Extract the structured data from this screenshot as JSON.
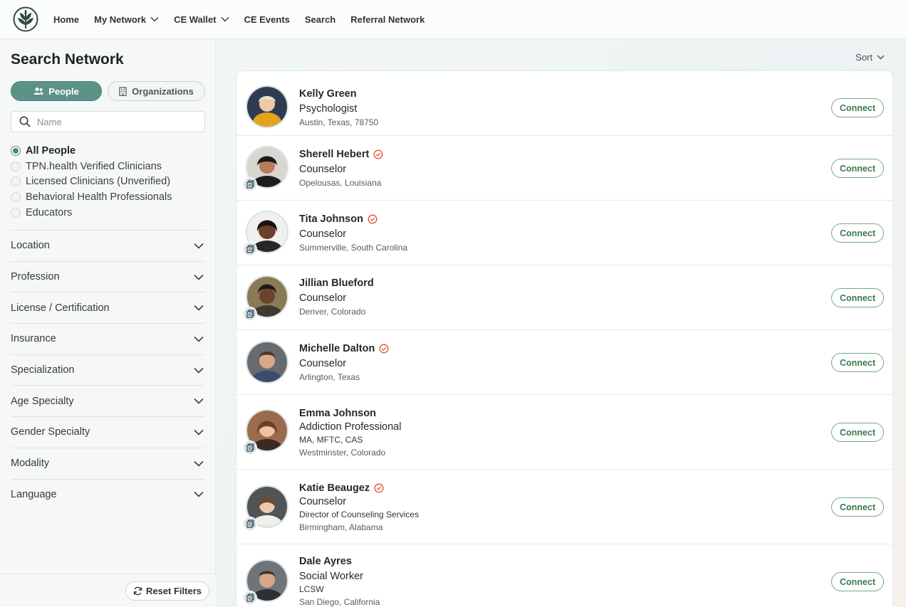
{
  "nav": {
    "items": [
      {
        "label": "Home",
        "dropdown": false
      },
      {
        "label": "My Network",
        "dropdown": true
      },
      {
        "label": "CE Wallet",
        "dropdown": true
      },
      {
        "label": "CE Events",
        "dropdown": false
      },
      {
        "label": "Search",
        "dropdown": false
      },
      {
        "label": "Referral Network",
        "dropdown": false
      }
    ]
  },
  "sidebar": {
    "title": "Search Network",
    "tabs": {
      "people": "People",
      "organizations": "Organizations",
      "active": "people"
    },
    "search": {
      "placeholder": "Name",
      "value": ""
    },
    "audience": [
      {
        "label": "All People",
        "selected": true
      },
      {
        "label": "TPN.health Verified Clinicians",
        "selected": false
      },
      {
        "label": "Licensed Clinicians (Unverified)",
        "selected": false
      },
      {
        "label": "Behavioral Health Professionals",
        "selected": false
      },
      {
        "label": "Educators",
        "selected": false
      }
    ],
    "filters": [
      "Location",
      "Profession",
      "License / Certification",
      "Insurance",
      "Specialization",
      "Age Specialty",
      "Gender Specialty",
      "Modality",
      "Language"
    ],
    "reset_label": "Reset Filters"
  },
  "main": {
    "sort_label": "Sort",
    "connect_label": "Connect",
    "results": [
      {
        "name": "Kelly Green",
        "verified": false,
        "doc_badge": false,
        "role": "Psychologist",
        "credentials": "",
        "location": "Austin, Texas, 78750"
      },
      {
        "name": "Sherell Hebert",
        "verified": true,
        "doc_badge": true,
        "role": "Counselor",
        "credentials": "",
        "location": "Opelousas, Louisiana"
      },
      {
        "name": "Tita Johnson",
        "verified": true,
        "doc_badge": true,
        "role": "Counselor",
        "credentials": "",
        "location": "Summerville, South Carolina"
      },
      {
        "name": "Jillian Blueford",
        "verified": false,
        "doc_badge": true,
        "role": "Counselor",
        "credentials": "",
        "location": "Denver, Colorado"
      },
      {
        "name": "Michelle Dalton",
        "verified": true,
        "doc_badge": false,
        "role": "Counselor",
        "credentials": "",
        "location": "Arlington, Texas"
      },
      {
        "name": "Emma Johnson",
        "verified": false,
        "doc_badge": true,
        "role": "Addiction Professional",
        "credentials": "MA, MFTC, CAS",
        "location": "Westminster, Colorado"
      },
      {
        "name": "Katie Beaugez",
        "verified": true,
        "doc_badge": true,
        "role": "Counselor",
        "credentials": "Director of Counseling Services",
        "location": "Birmingham, Alabama"
      },
      {
        "name": "Dale Ayres",
        "verified": false,
        "doc_badge": true,
        "role": "Social Worker",
        "credentials": "LCSW",
        "location": "San Diego, California"
      }
    ]
  },
  "colors": {
    "accent": "#5d9288",
    "verified": "#e0502c",
    "connect_text": "#3b7a4d"
  }
}
